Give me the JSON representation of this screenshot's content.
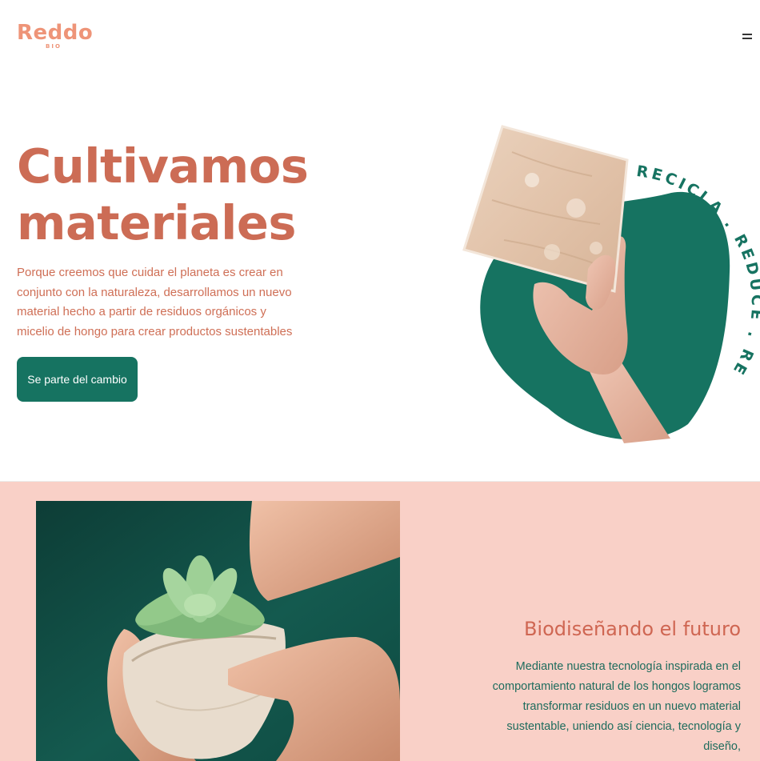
{
  "header": {
    "logo_text": "Reddo",
    "logo_sub": "BIO",
    "menu_icon": "hamburger-icon"
  },
  "hero": {
    "title_line1": "Cultivamos",
    "title_line2": "materiales",
    "description": "Porque creemos que cuidar el planeta es crear en conjunto con la naturaleza, desarrollamos un nuevo material hecho a partir de residuos orgánicos y micelio de hongo para crear productos sustentables",
    "cta_label": "Se parte del cambio",
    "badge_text": "RECICLA . REDUCE . REDDO"
  },
  "section2": {
    "title": "Biodiseñando el futuro",
    "text": "Mediante nuestra tecnología inspirada en el comportamiento natural de los hongos logramos transformar residuos en un nuevo material sustentable, uniendo así ciencia, tecnología y diseño,"
  },
  "colors": {
    "brand_coral": "#ee9478",
    "title_terracotta": "#cc6c55",
    "brand_green": "#167361",
    "section_pink": "#f9d0c7"
  }
}
